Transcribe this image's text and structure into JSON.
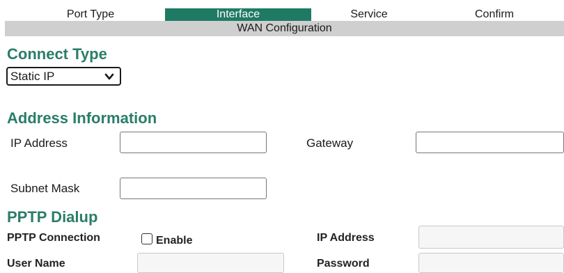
{
  "wizard": {
    "tabs": [
      {
        "label": "Port Type"
      },
      {
        "label": "Interface"
      },
      {
        "label": "Service"
      },
      {
        "label": "Confirm"
      }
    ],
    "active_tab": "Interface",
    "banner": "WAN  Configuration"
  },
  "connect_type": {
    "heading": "Connect Type",
    "selected": "Static IP"
  },
  "address_info": {
    "heading": "Address Information",
    "ip_label": "IP Address",
    "ip_value": "",
    "gateway_label": "Gateway",
    "gateway_value": "",
    "mask_label": "Subnet Mask",
    "mask_value": ""
  },
  "pptp": {
    "heading": "PPTP Dialup",
    "connection_label": "PPTP Connection",
    "enable_label": "Enable",
    "enabled": false,
    "ip_label": "IP Address",
    "ip_value": "",
    "user_label": "User Name",
    "user_value": "",
    "password_label": "Password",
    "password_value": ""
  },
  "colors": {
    "accent": "#1f7a64",
    "heading": "#2a7d68",
    "banner_bg": "#cfcfcf"
  }
}
